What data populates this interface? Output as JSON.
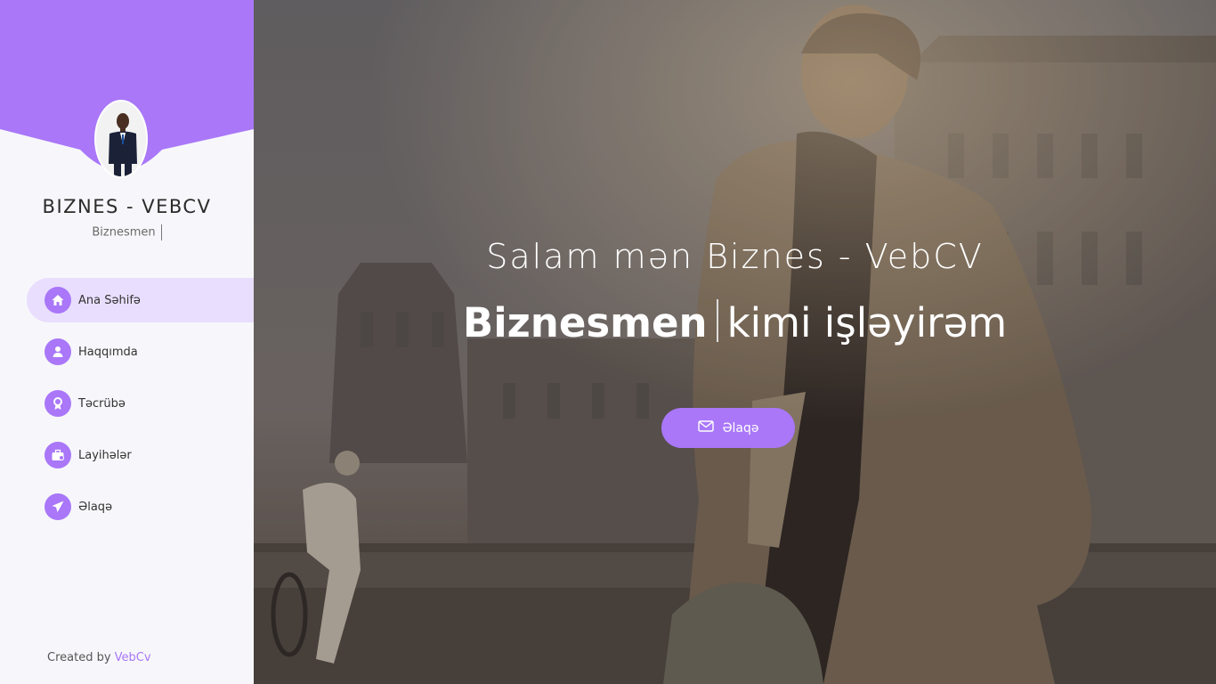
{
  "sidebar": {
    "brand_title": "BIZNES - VEBCV",
    "brand_subtitle": "Biznesmen",
    "items": [
      {
        "label": "Ana Səhifə",
        "icon": "home-icon",
        "active": true
      },
      {
        "label": "Haqqımda",
        "icon": "user-icon",
        "active": false
      },
      {
        "label": "Təcrübə",
        "icon": "award-icon",
        "active": false
      },
      {
        "label": "Layihələr",
        "icon": "briefcase-icon",
        "active": false
      },
      {
        "label": "Əlaqə",
        "icon": "send-icon",
        "active": false
      }
    ],
    "footer_prefix": "Created by",
    "footer_link": "VebCv"
  },
  "hero": {
    "greeting": "Salam mən Biznes - VebCV",
    "role": "Biznesmen",
    "role_suffix": "kimi işləyirəm",
    "cta_label": "Əlaqə",
    "cta_icon": "mail-icon"
  },
  "colors": {
    "accent": "#a977f8",
    "active_bg": "#e9defe",
    "sidebar_bg": "#f7f7fb"
  }
}
